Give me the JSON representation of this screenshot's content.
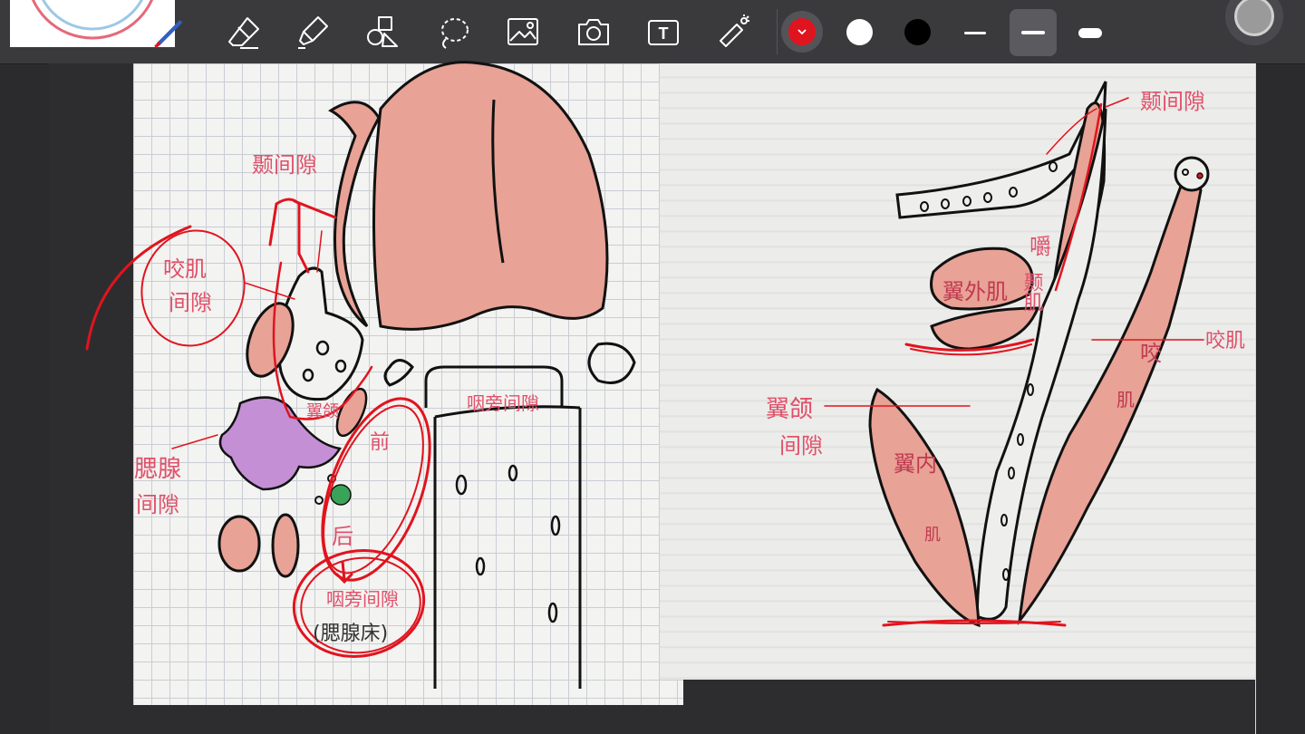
{
  "toolbar": {
    "tools": [
      {
        "name": "pen-tool",
        "icon": "pen-icon"
      },
      {
        "name": "eraser-tool",
        "icon": "eraser-icon"
      },
      {
        "name": "highlighter-tool",
        "icon": "highlighter-icon"
      },
      {
        "name": "shapes-tool",
        "icon": "shapes-icon"
      },
      {
        "name": "lasso-tool",
        "icon": "lasso-icon"
      },
      {
        "name": "image-tool",
        "icon": "image-icon"
      },
      {
        "name": "camera-tool",
        "icon": "camera-icon"
      },
      {
        "name": "text-tool",
        "icon": "text-icon"
      },
      {
        "name": "laser-pointer-tool",
        "icon": "laser-pointer-icon"
      }
    ],
    "colors": [
      {
        "name": "red",
        "hex": "#e0141e",
        "selected": true
      },
      {
        "name": "white",
        "hex": "#ffffff",
        "selected": false
      },
      {
        "name": "black",
        "hex": "#000000",
        "selected": false
      }
    ],
    "stroke_widths": [
      {
        "name": "thin",
        "selected": false
      },
      {
        "name": "medium",
        "selected": true
      },
      {
        "name": "thick",
        "selected": false
      }
    ]
  },
  "accent_color": "#e0141e",
  "annotations": {
    "left": {
      "label_1": "颞间隙",
      "label_2": "咬肌",
      "label_3": "间隙",
      "label_4": "腮腺",
      "label_5": "间隙",
      "label_6": "咽旁间隙",
      "label_7": "前",
      "label_8": "后",
      "label_9": "咽旁间隙",
      "label_10": "(腮腺床)",
      "label_11": "翼颌"
    },
    "right": {
      "label_1": "颞间隙",
      "label_2": "翼外肌",
      "label_3": "颞肌",
      "label_4": "咬",
      "label_5": "肌",
      "label_6": "咬肌",
      "label_7": "翼颌",
      "label_8": "间隙",
      "label_9": "翼内",
      "label_10": "肌",
      "label_11": "嚼"
    }
  }
}
